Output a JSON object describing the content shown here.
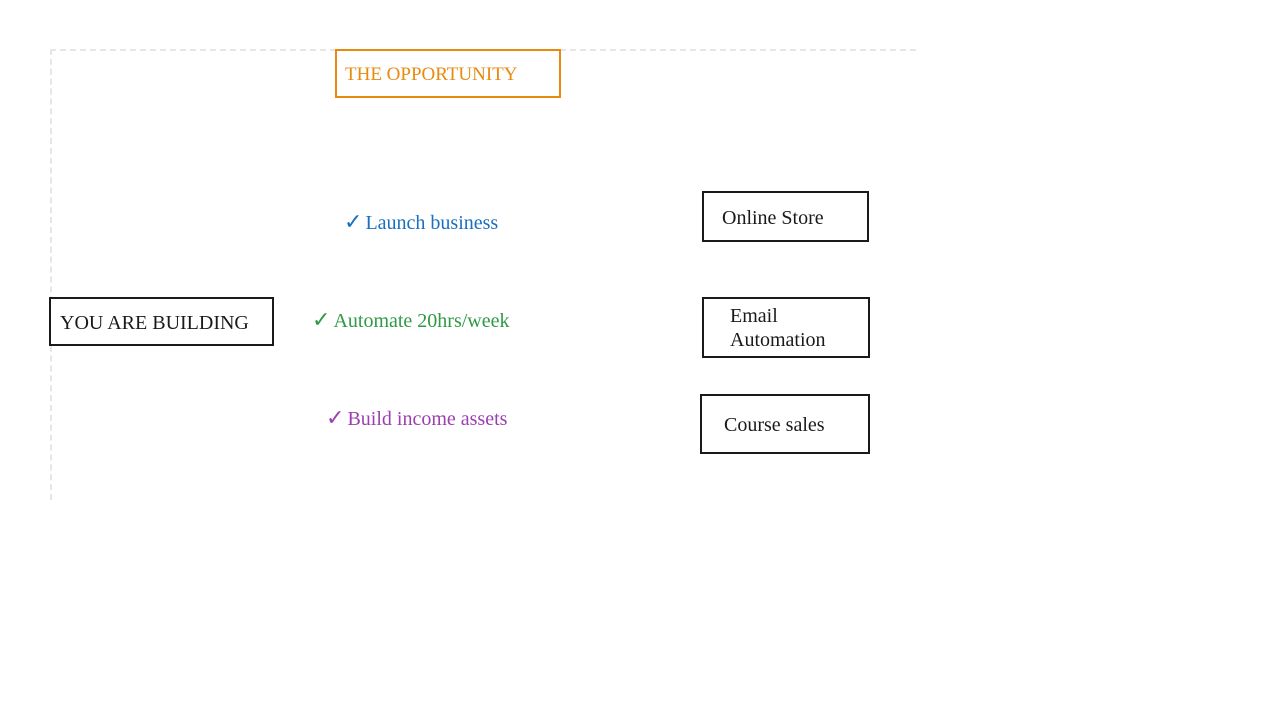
{
  "diagram": {
    "title": "THE OPPORTUNITY",
    "source_label": "YOU ARE BUILDING",
    "checkmark_glyph": "✓",
    "benefits": [
      {
        "label": "Launch business",
        "color": "#1a6fbf"
      },
      {
        "label": "Automate 20hrs/week",
        "color": "#2e9a45"
      },
      {
        "label": "Build income assets",
        "color": "#9b3fb0"
      }
    ],
    "outcomes": [
      {
        "label": "Online Store"
      },
      {
        "label": "Email Automation"
      },
      {
        "label": "Course sales"
      }
    ],
    "colors": {
      "title_accent": "#e88a0c",
      "box_border": "#1a1a1a",
      "frame_dash": "#e6e6e6"
    }
  }
}
